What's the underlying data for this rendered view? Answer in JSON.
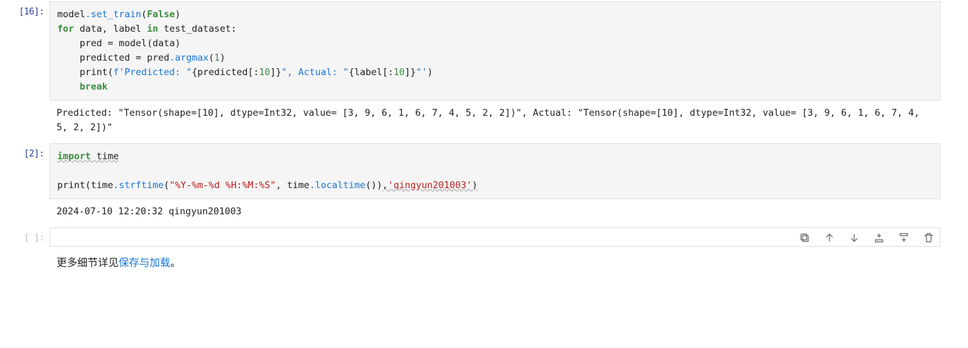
{
  "cells": [
    {
      "prompt": "[16]:",
      "code": {
        "l1_model": "model",
        "l1_set_train": ".set_train",
        "l1_False": "False",
        "l2_for": "for",
        "l2_data": " data",
        "l2_comma": ",",
        "l2_label": " label ",
        "l2_in": "in",
        "l2_test_dataset": " test_dataset",
        "l3_pred": "    pred ",
        "l3_eq": "=",
        "l3_model": " model(data)",
        "l4_predicted": "    predicted ",
        "l4_eq": "=",
        "l4_pred": " pred",
        "l4_argmax": ".argmax",
        "l4_one": "1",
        "l5_print": "    print(",
        "l5_fpre": "f'Predicted: \"",
        "l5_int1a": "{",
        "l5_int1b": "predicted[:",
        "l5_int1n": "10",
        "l5_int1c": "]",
        "l5_int1d": "}",
        "l5_mid": "\", Actual: \"",
        "l5_int2a": "{",
        "l5_int2b": "label[:",
        "l5_int2n": "10",
        "l5_int2c": "]",
        "l5_int2d": "}",
        "l5_end": "\"'",
        "l6_break": "break"
      },
      "output": "Predicted: \"Tensor(shape=[10], dtype=Int32, value= [3, 9, 6, 1, 6, 7, 4, 5, 2, 2])\", Actual: \"Tensor(shape=[10], dtype=Int32, value= [3, 9, 6, 1, 6, 7, 4, 5, 2, 2])\""
    },
    {
      "prompt": "[2]:",
      "code": {
        "l1_import": "import",
        "l1_time": " time",
        "l3_print": "print(",
        "l3_time1": "time",
        "l3_strftime": ".strftime",
        "l3_fmt": "\"%Y-%m-%d %H:%M:%S\"",
        "l3_comma": ", ",
        "l3_time2": "time",
        "l3_localtime": ".localtime",
        "l3_paren": "())",
        "l3_comma2": ",",
        "l3_user": "'qingyun201003'",
        "l3_close": ")"
      },
      "output": "2024-07-10 12:20:32 qingyun201003"
    },
    {
      "prompt": "[ ]:"
    }
  ],
  "markdown": {
    "prefix": "更多细节详见",
    "link_text": "保存与加载",
    "suffix": "。"
  },
  "toolbar": {
    "duplicate": "duplicate",
    "move_up": "move-up",
    "move_down": "move-down",
    "insert_above": "insert-above",
    "insert_below": "insert-below",
    "delete": "delete"
  }
}
